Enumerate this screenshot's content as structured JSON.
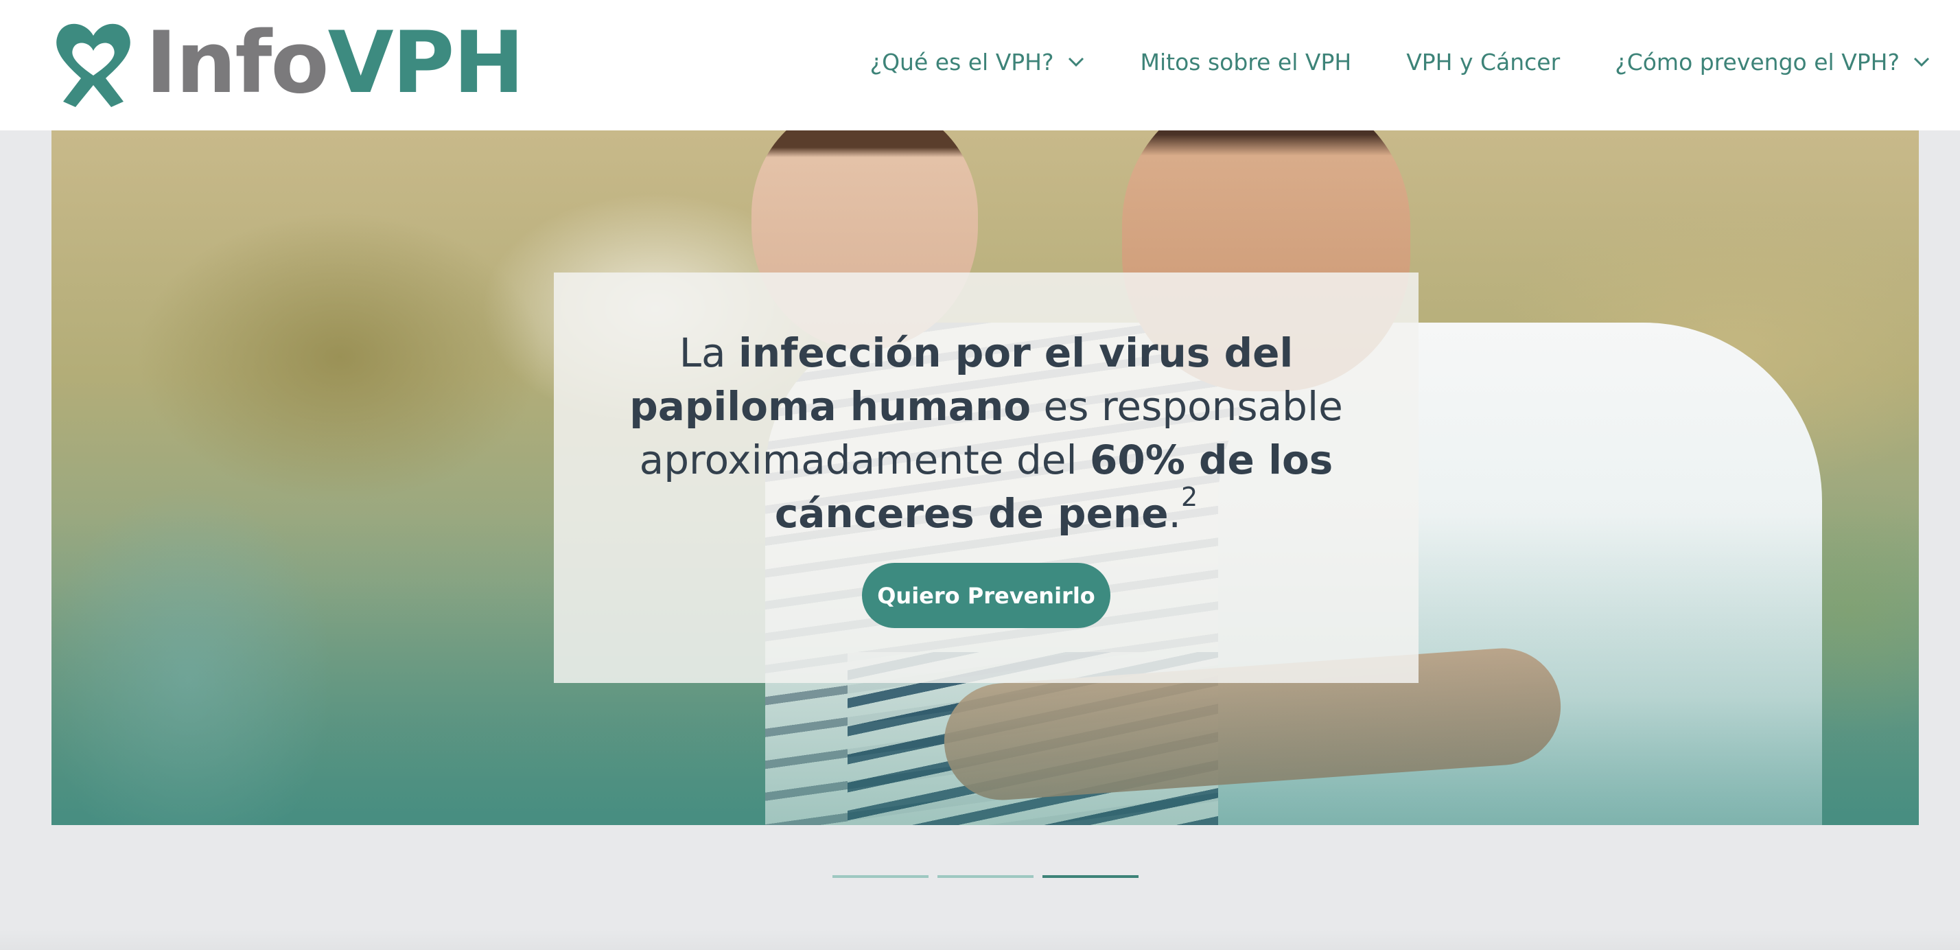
{
  "header": {
    "logo": {
      "text_info": "Info",
      "text_vph": "VPH",
      "icon": "heart-ribbon-icon"
    },
    "nav": [
      {
        "label": "¿Qué es el VPH?",
        "has_dropdown": true
      },
      {
        "label": "Mitos sobre el VPH",
        "has_dropdown": false
      },
      {
        "label": "VPH y Cáncer",
        "has_dropdown": false
      },
      {
        "label": "¿Cómo prevengo el VPH?",
        "has_dropdown": true
      }
    ]
  },
  "hero": {
    "text": {
      "p1": "La ",
      "b1": "infección por el virus del papiloma humano",
      "p2": " es responsable aproximadamente del ",
      "b2": "60% de los cánceres de pene",
      "p3": ".",
      "sup": "2"
    },
    "cta_label": "Quiero Prevenirlo"
  },
  "carousel": {
    "slides": 3,
    "active_index": 2
  },
  "colors": {
    "brand_teal": "#3d8b80",
    "logo_gray": "#7b7a7c",
    "nav_text": "#3d8378",
    "text_dark": "#33404d",
    "page_bg": "#e8e9eb"
  }
}
